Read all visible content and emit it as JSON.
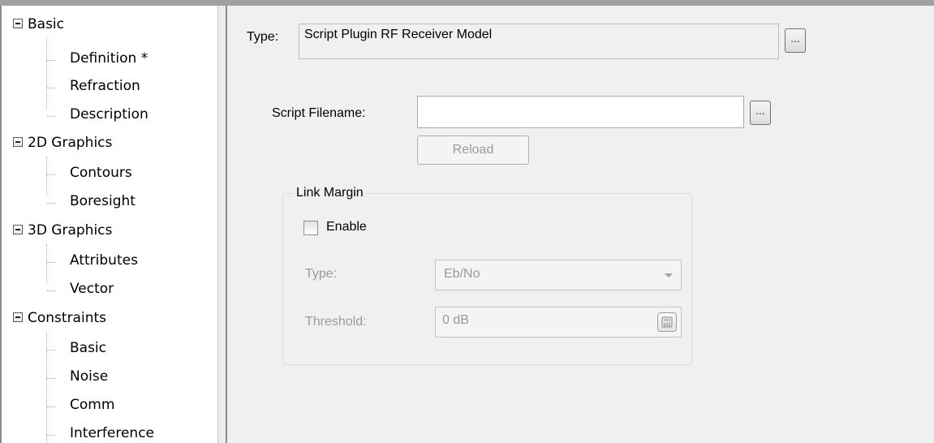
{
  "tree": {
    "groups": [
      {
        "label": "Basic",
        "items": [
          "Definition *",
          "Refraction",
          "Description"
        ]
      },
      {
        "label": "2D Graphics",
        "items": [
          "Contours",
          "Boresight"
        ]
      },
      {
        "label": "3D Graphics",
        "items": [
          "Attributes",
          "Vector"
        ]
      },
      {
        "label": "Constraints",
        "items": [
          "Basic",
          "Noise",
          "Comm",
          "Interference"
        ]
      }
    ]
  },
  "type_row": {
    "label": "Type:",
    "value": "Script Plugin RF Receiver Model",
    "button": "..."
  },
  "script": {
    "label": "Script Filename:",
    "value": "",
    "button": "...",
    "reload": "Reload"
  },
  "link_margin": {
    "title": "Link Margin",
    "enable_label": "Enable",
    "enabled": false,
    "type_label": "Type:",
    "type_value": "Eb/No",
    "threshold_label": "Threshold:",
    "threshold_value": "0 dB"
  }
}
